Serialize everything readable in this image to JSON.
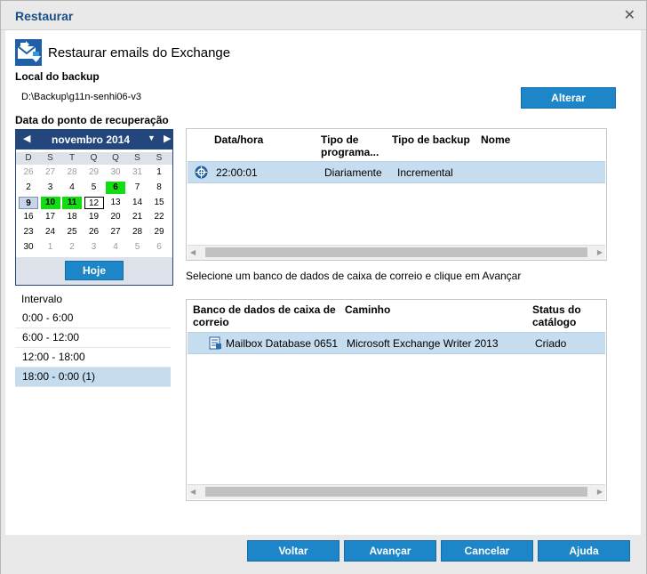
{
  "dialog": {
    "title": "Restaurar",
    "close_glyph": "✕"
  },
  "header": {
    "title": "Restaurar emails do Exchange",
    "icon": "exchange-restore-icon"
  },
  "backup_location": {
    "label": "Local do backup",
    "path": "D:\\Backup\\g11n-senhi06-v3",
    "change_button": "Alterar"
  },
  "recovery_point": {
    "label": "Data do ponto de recuperação",
    "calendar": {
      "month": "novembro 2014",
      "weekdays": [
        "D",
        "S",
        "T",
        "Q",
        "Q",
        "S",
        "S"
      ],
      "weeks": [
        [
          {
            "d": "26",
            "t": "other"
          },
          {
            "d": "27",
            "t": "other"
          },
          {
            "d": "28",
            "t": "other"
          },
          {
            "d": "29",
            "t": "other"
          },
          {
            "d": "30",
            "t": "other"
          },
          {
            "d": "31",
            "t": "other"
          },
          {
            "d": "1",
            "t": ""
          }
        ],
        [
          {
            "d": "2",
            "t": ""
          },
          {
            "d": "3",
            "t": ""
          },
          {
            "d": "4",
            "t": ""
          },
          {
            "d": "5",
            "t": ""
          },
          {
            "d": "6",
            "t": "green"
          },
          {
            "d": "7",
            "t": ""
          },
          {
            "d": "8",
            "t": ""
          }
        ],
        [
          {
            "d": "9",
            "t": "sel"
          },
          {
            "d": "10",
            "t": "green"
          },
          {
            "d": "11",
            "t": "green"
          },
          {
            "d": "12",
            "t": "today"
          },
          {
            "d": "13",
            "t": ""
          },
          {
            "d": "14",
            "t": ""
          },
          {
            "d": "15",
            "t": ""
          }
        ],
        [
          {
            "d": "16",
            "t": ""
          },
          {
            "d": "17",
            "t": ""
          },
          {
            "d": "18",
            "t": ""
          },
          {
            "d": "19",
            "t": ""
          },
          {
            "d": "20",
            "t": ""
          },
          {
            "d": "21",
            "t": ""
          },
          {
            "d": "22",
            "t": ""
          }
        ],
        [
          {
            "d": "23",
            "t": ""
          },
          {
            "d": "24",
            "t": ""
          },
          {
            "d": "25",
            "t": ""
          },
          {
            "d": "26",
            "t": ""
          },
          {
            "d": "27",
            "t": ""
          },
          {
            "d": "28",
            "t": ""
          },
          {
            "d": "29",
            "t": ""
          }
        ],
        [
          {
            "d": "30",
            "t": ""
          },
          {
            "d": "1",
            "t": "other"
          },
          {
            "d": "2",
            "t": "other"
          },
          {
            "d": "3",
            "t": "other"
          },
          {
            "d": "4",
            "t": "other"
          },
          {
            "d": "5",
            "t": "other"
          },
          {
            "d": "6",
            "t": "other"
          }
        ]
      ],
      "today_button": "Hoje"
    }
  },
  "interval": {
    "label": "Intervalo",
    "items": [
      "0:00 - 6:00",
      "6:00 - 12:00",
      "12:00 - 18:00",
      "18:00 - 0:00   (1)"
    ],
    "selected": 3
  },
  "backup_grid": {
    "headers": [
      "Data/hora",
      "Tipo de programa...",
      "Tipo de backup",
      "Nome"
    ],
    "rows": [
      {
        "time": "22:00:01",
        "schedule": "Diariamente",
        "type": "Incremental",
        "name": ""
      }
    ]
  },
  "select_message": "Selecione um banco de dados de caixa de correio e clique em Avançar",
  "mailbox_grid": {
    "headers": [
      "Banco de dados de caixa de correio",
      "Caminho",
      "Status do catálogo"
    ],
    "rows": [
      {
        "db": "Mailbox Database 0651",
        "path": "Microsoft Exchange Writer 2013",
        "status": "Criado"
      }
    ]
  },
  "footer": {
    "back": "Voltar",
    "next": "Avançar",
    "cancel": "Cancelar",
    "help": "Ajuda"
  },
  "colors": {
    "accent": "#1d86c8",
    "calendar_header": "#23477c",
    "selected_row": "#c6dcef",
    "recovery_day": "#11dd11"
  }
}
